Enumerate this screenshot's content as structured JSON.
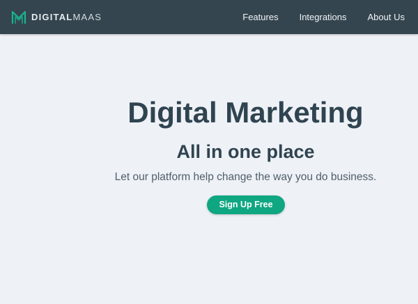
{
  "navbar": {
    "brand": {
      "logo_icon": "m-monogram-logo-icon",
      "text_bold": "DIGITAL",
      "text_light": "MAAS"
    },
    "links": [
      {
        "label": "Features"
      },
      {
        "label": "Integrations"
      },
      {
        "label": "About Us"
      }
    ]
  },
  "hero": {
    "title": "Digital Marketing",
    "subtitle": "All in one place",
    "text": "Let our platform help change the way you do business.",
    "cta_label": "Sign Up Free"
  },
  "colors": {
    "navbar_bg": "#34454f",
    "page_bg": "#eef1f6",
    "accent": "#0fa682",
    "heading": "#2f4450"
  }
}
